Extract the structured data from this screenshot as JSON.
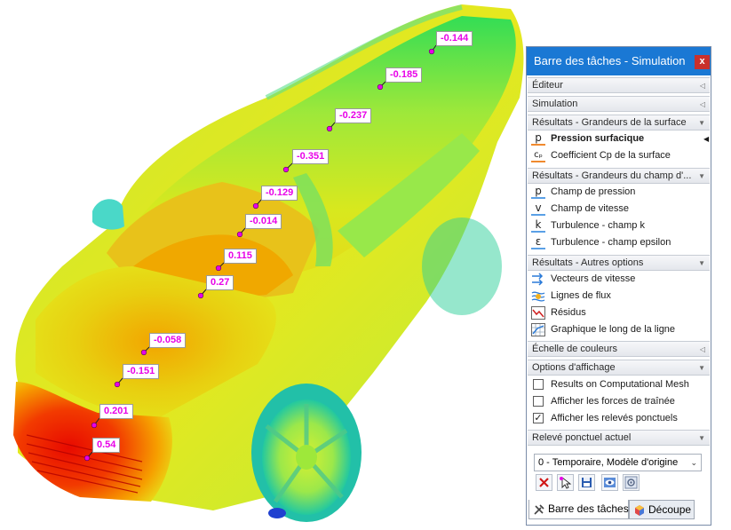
{
  "probes": [
    {
      "id": "p1",
      "value": "-0.144"
    },
    {
      "id": "p2",
      "value": "-0.185"
    },
    {
      "id": "p3",
      "value": "-0.237"
    },
    {
      "id": "p4",
      "value": "-0.351"
    },
    {
      "id": "p5",
      "value": "-0.129"
    },
    {
      "id": "p6",
      "value": "-0.014"
    },
    {
      "id": "p7",
      "value": "0.115"
    },
    {
      "id": "p8",
      "value": "0.27"
    },
    {
      "id": "p9",
      "value": "-0.058"
    },
    {
      "id": "p10",
      "value": "-0.151"
    },
    {
      "id": "p11",
      "value": "0.201"
    },
    {
      "id": "p12",
      "value": "0.54"
    }
  ],
  "probe_color": "#e800e8",
  "panel": {
    "title": "Barre des tâches - Simulation",
    "close": "x",
    "sections": {
      "editor": "Éditeur",
      "simulation": "Simulation",
      "surface": "Résultats - Grandeurs de la surface",
      "field": "Résultats - Grandeurs du champ d'...",
      "other": "Résultats - Autres options",
      "scale": "Échelle de couleurs",
      "display": "Options d'affichage",
      "probe": "Relevé ponctuel actuel"
    },
    "surface_items": [
      "Pression surfacique",
      "Coefficient Cp de la surface"
    ],
    "field_items": [
      "Champ de pression",
      "Champ de vitesse",
      "Turbulence - champ k",
      "Turbulence - champ epsilon"
    ],
    "field_icons": [
      "p",
      "v",
      "k",
      "ε"
    ],
    "other_items": [
      "Vecteurs de vitesse",
      "Lignes de flux",
      "Résidus",
      "Graphique le long de la ligne"
    ],
    "display_items": [
      {
        "label": "Results on Computational Mesh",
        "checked": false
      },
      {
        "label": "Afficher les forces de traînée",
        "checked": false
      },
      {
        "label": "Afficher les relevés ponctuels",
        "checked": true
      }
    ],
    "probe_select": "0 - Temporaire, Modèle d'origine",
    "tabs": [
      "Barre des tâches",
      "Découpe"
    ]
  },
  "colors": {
    "titlebar": "#1a78d4",
    "close": "#c9302c",
    "accent_blue": "#5aa0e6",
    "accent_orange": "#f08a2e"
  }
}
